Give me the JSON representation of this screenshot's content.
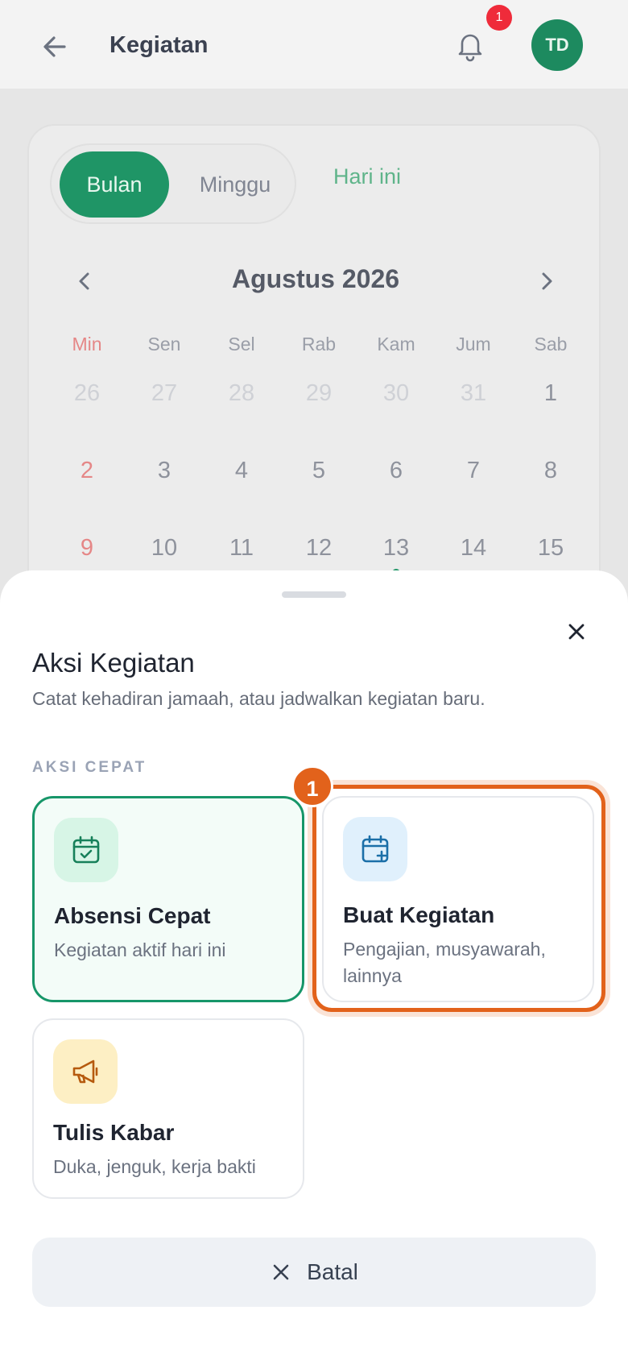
{
  "header": {
    "title": "Kegiatan",
    "notification_count": "1",
    "avatar_initials": "TD"
  },
  "calendar": {
    "view_toggle": {
      "month": "Bulan",
      "week": "Minggu"
    },
    "today_label": "Hari ini",
    "month_label": "Agustus 2026",
    "weekdays": [
      "Min",
      "Sen",
      "Sel",
      "Rab",
      "Kam",
      "Jum",
      "Sab"
    ],
    "weeks": [
      [
        "26",
        "27",
        "28",
        "29",
        "30",
        "31",
        "1"
      ],
      [
        "2",
        "3",
        "4",
        "5",
        "6",
        "7",
        "8"
      ],
      [
        "9",
        "10",
        "11",
        "12",
        "13",
        "14",
        "15"
      ]
    ],
    "event_marker_day": "13"
  },
  "sheet": {
    "title": "Aksi Kegiatan",
    "subtitle": "Catat kehadiran jamaah, atau jadwalkan kegiatan baru.",
    "section_label": "AKSI CEPAT",
    "actions": [
      {
        "title": "Absensi Cepat",
        "desc": "Kegiatan aktif hari ini",
        "icon": "calendar-check-icon"
      },
      {
        "title": "Buat Kegiatan",
        "desc": "Pengajian, musyawarah, lainnya",
        "icon": "calendar-plus-icon"
      },
      {
        "title": "Tulis Kabar",
        "desc": "Duka, jenguk, kerja bakti",
        "icon": "megaphone-icon"
      }
    ],
    "step_marker": "1",
    "cancel_label": "Batal"
  },
  "colors": {
    "primary": "#1f9566",
    "highlight": "#e2621b",
    "badge": "#ef2b3a",
    "sunday": "#e58787"
  }
}
